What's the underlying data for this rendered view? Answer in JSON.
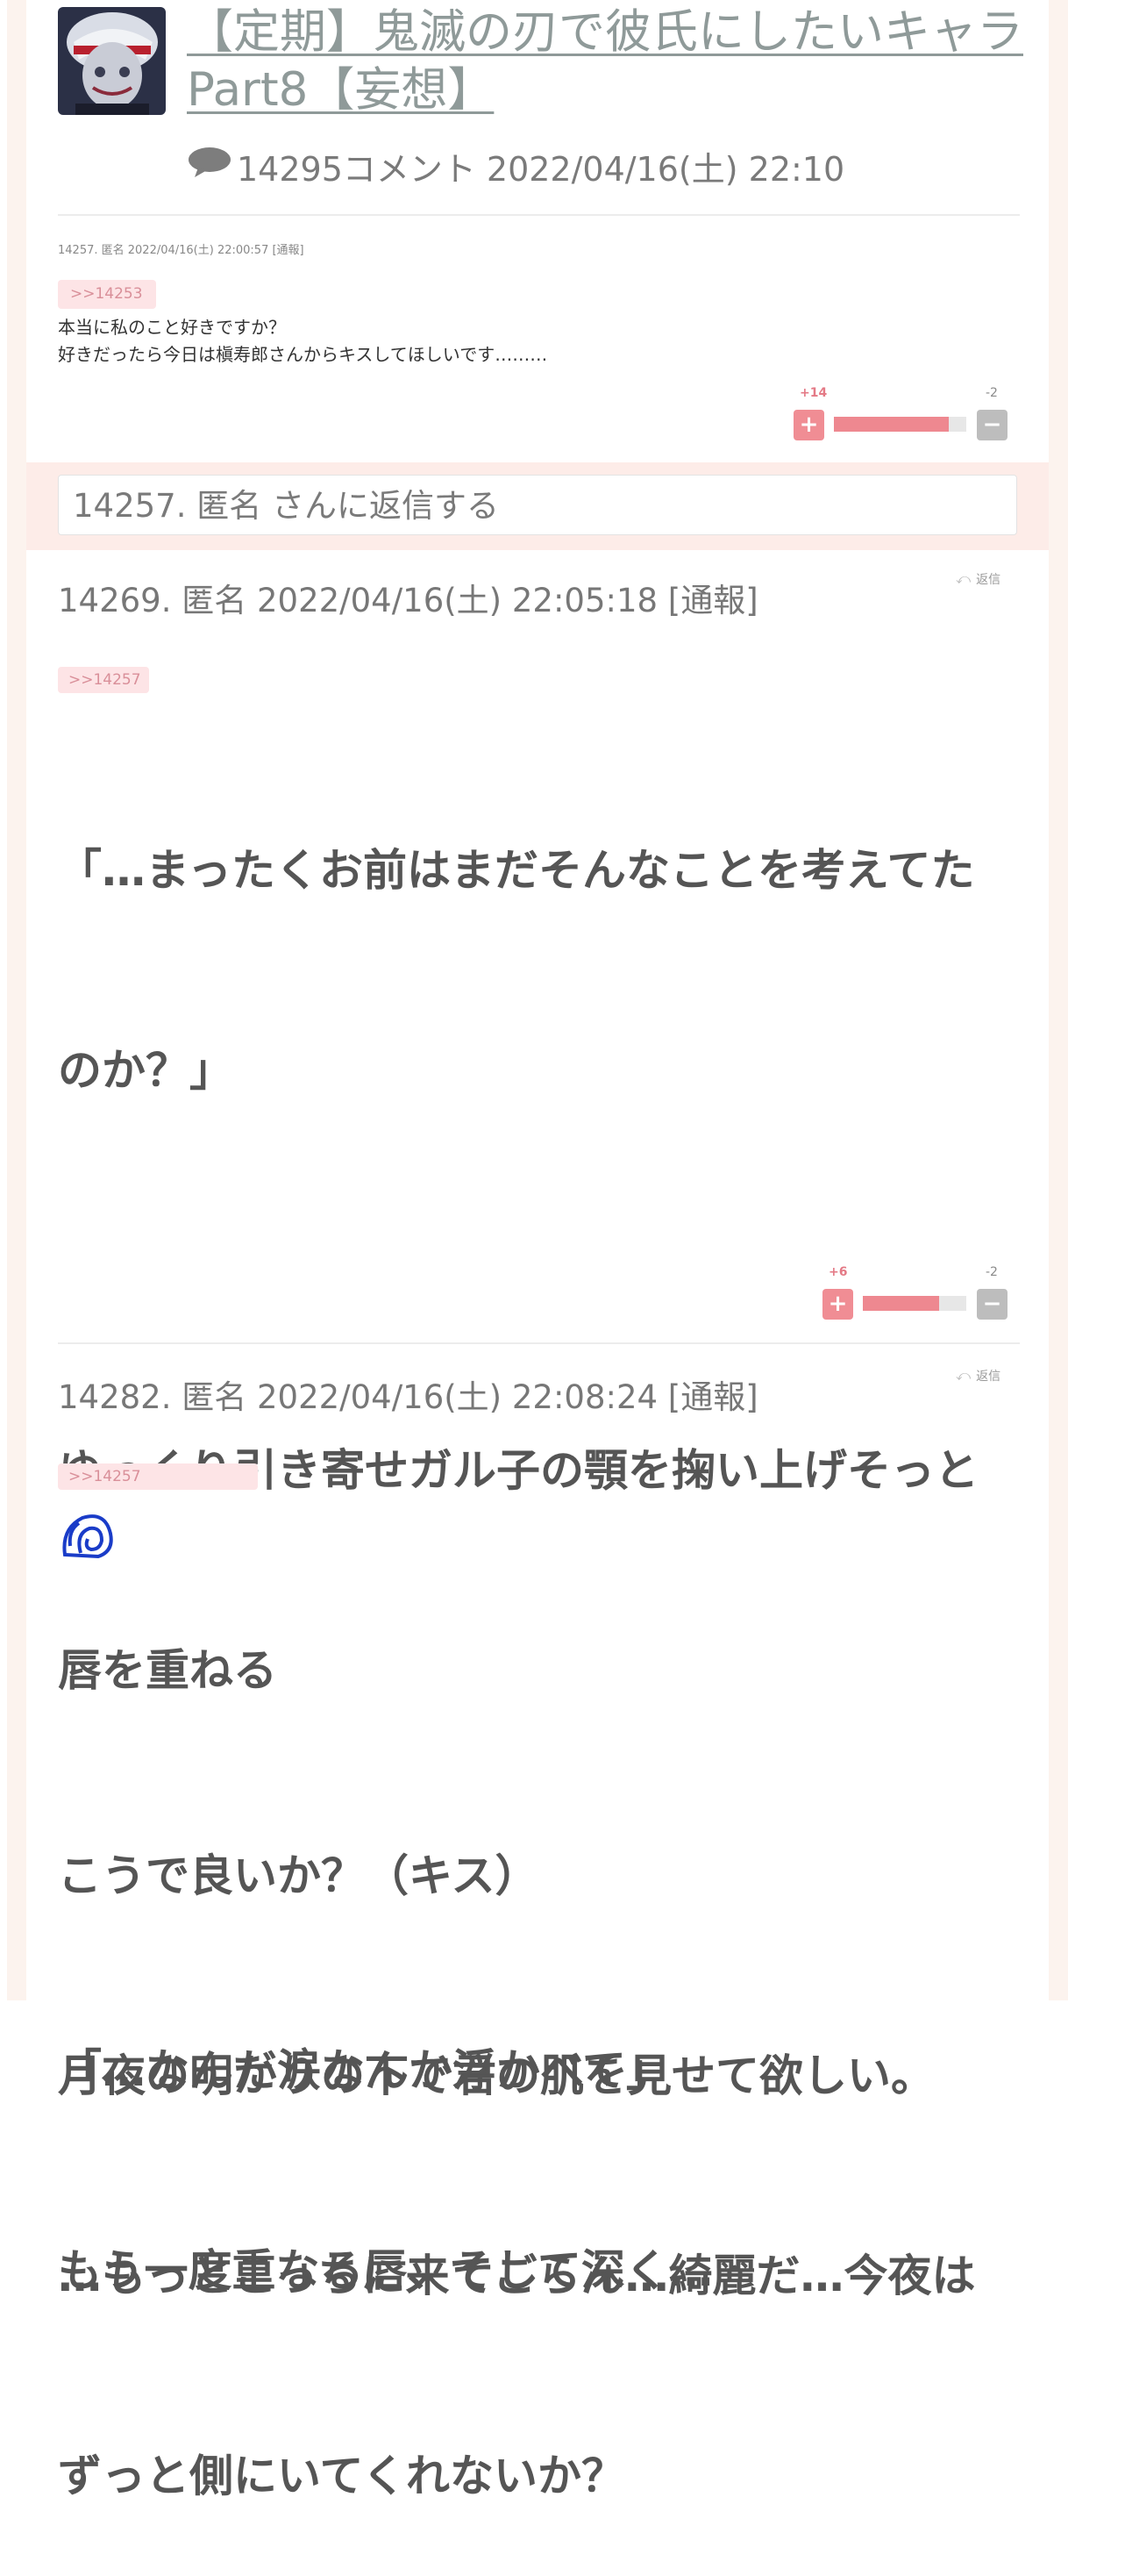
{
  "thread": {
    "title": "【定期】鬼滅の刃で彼氏にしたいキャラPart8【妄想】",
    "comment_count": "14295コメント",
    "datetime": "2022/04/16(土) 22:10"
  },
  "comments": [
    {
      "header": "14257. 匿名 2022/04/16(土) 22:00:57 [通報]",
      "anchor": ">>14253",
      "lines": [
        "本当に私のこと好きですか？",
        "好きだったら今日は槇寿郎さんからキスしてほしいです………"
      ],
      "plus": "+14",
      "minus": "-2",
      "plus_ratio": 0.87
    },
    {
      "header": "14269. 匿名 2022/04/16(土) 22:05:18 [通報]",
      "reply_label": "返信",
      "anchor": ">>14257",
      "lines": [
        "「…まったくお前はまだそんなことを考えてた",
        "のか？」",
        "",
        "ゆっくり引き寄せガル子の顎を掬い上げそっと",
        "唇を重ねる",
        "",
        "「…なんだ涙なんか浮かべて」",
        "もう一度重なる唇、そして深く…"
      ],
      "plus": "+6",
      "minus": "-2",
      "plus_ratio": 0.74
    },
    {
      "header": "14282. 匿名 2022/04/16(土) 22:08:24 [通報]",
      "reply_label": "返信",
      "anchor": ">>14257",
      "lines": [
        "こうで良いか？（キス）",
        "月夜の明かりの下で君の肌を見せて欲しい。",
        "…もっとこっちに来てごらん…綺麗だ…今夜は",
        "ずっと側にいてくれないか？"
      ]
    }
  ],
  "reply_box": {
    "text": "14257. 匿名 さんに返信する"
  },
  "icons": {
    "comment": "speech-bubble-icon",
    "reply": "reply-arrow-icon",
    "plus": "plus-icon",
    "minus": "minus-icon",
    "emoji": "spiral-shell-emoji"
  },
  "colors": {
    "accent_pink": "#ee8890",
    "title_gray": "#8f9a99",
    "page_band": "#fdece8"
  }
}
